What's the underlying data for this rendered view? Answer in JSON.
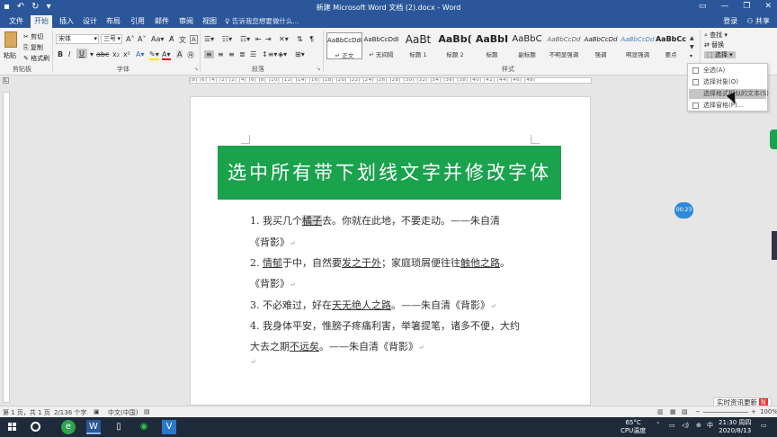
{
  "window": {
    "title": "新建 Microsoft Word 文档 (2).docx - Word",
    "qat_icons": [
      "save-icon",
      "undo-icon",
      "redo-icon",
      "customize-icon"
    ]
  },
  "tabs": [
    {
      "label": "文件"
    },
    {
      "label": "开始"
    },
    {
      "label": "插入"
    },
    {
      "label": "设计"
    },
    {
      "label": "布局"
    },
    {
      "label": "引用"
    },
    {
      "label": "邮件"
    },
    {
      "label": "审阅"
    },
    {
      "label": "视图"
    }
  ],
  "tell_me": "告诉我您想要做什么...",
  "account": {
    "login": "登录",
    "share": "共享"
  },
  "clipboard": {
    "paste": "粘贴",
    "cut": "剪切",
    "copy": "复制",
    "format_painter": "格式刷",
    "group": "剪贴板"
  },
  "font": {
    "name": "宋体",
    "size": "三号",
    "group": "字体"
  },
  "paragraph": {
    "group": "段落"
  },
  "styles": {
    "group": "样式",
    "items": [
      {
        "sample": "AaBbCcDdI",
        "name": "正文"
      },
      {
        "sample": "AaBbCcDdI",
        "name": "无间隔"
      },
      {
        "sample": "AaBt",
        "name": "标题 1"
      },
      {
        "sample": "AaBb(",
        "name": "标题 2"
      },
      {
        "sample": "AaBbI",
        "name": "标题"
      },
      {
        "sample": "AaBbC",
        "name": "副标题"
      },
      {
        "sample": "AaBbCcDd",
        "name": "不明显强调"
      },
      {
        "sample": "AaBbCcDd",
        "name": "强调"
      },
      {
        "sample": "AaBbCcDd",
        "name": "明显强调"
      },
      {
        "sample": "AaBbCc",
        "name": "要点"
      }
    ]
  },
  "editing": {
    "find": "查找",
    "replace": "替换",
    "select": "选择"
  },
  "select_menu": {
    "items": [
      {
        "label": "全选(A)"
      },
      {
        "label": "选择对象(O)"
      },
      {
        "label": "选择格式相似的文本(S)"
      },
      {
        "label": "选择窗格(P)..."
      }
    ]
  },
  "ruler": {
    "marks": "|8|  |6|  |4|  |2|   |2|  |4|  |6|  |8|  |10| |12| |14| |16| |18| |20| |22| |24| |26| |28| |30| |32| |34| |36| |38| |40| |42| |44| |46| |48|"
  },
  "document": {
    "banner": "选中所有带下划线文字并修改字体",
    "lines": {
      "l1a": "1. 我买几个",
      "l1b": "橘子",
      "l1c": "去。你就在此地，不要走动。——朱自清",
      "l2": "《背影》",
      "l3a": "2. ",
      "l3b": "情郁",
      "l3c": "于中，自然要",
      "l3d": "发之于外",
      "l3e": "；家庭琐屑便往往",
      "l3f": "触他之路",
      "l3g": "。",
      "l4": "《背影》",
      "l5a": "3. 不必难过，好在",
      "l5b": "天无绝人之路",
      "l5c": "。——朱自清《背影》",
      "l6": "4. 我身体平安，惟膀子疼痛利害，举箸提笔，诸多不便，大约",
      "l7a": "大去之期",
      "l7b": "不远矣",
      "l7c": "。——朱自清《背影》"
    },
    "para_mark": "↵"
  },
  "float_bubble": "00:23",
  "news": {
    "label": "实时资讯更新",
    "badge": "N"
  },
  "statusbar": {
    "page": "第 1 页，共 1 页",
    "words": "2/136 个字",
    "lang": "中文(中国)",
    "zoom": "100%"
  },
  "taskbar": {
    "weather_temp": "65°C",
    "weather_label": "CPU温度",
    "time": "21:30 周四",
    "date": "2020/8/13",
    "ime": "中"
  }
}
